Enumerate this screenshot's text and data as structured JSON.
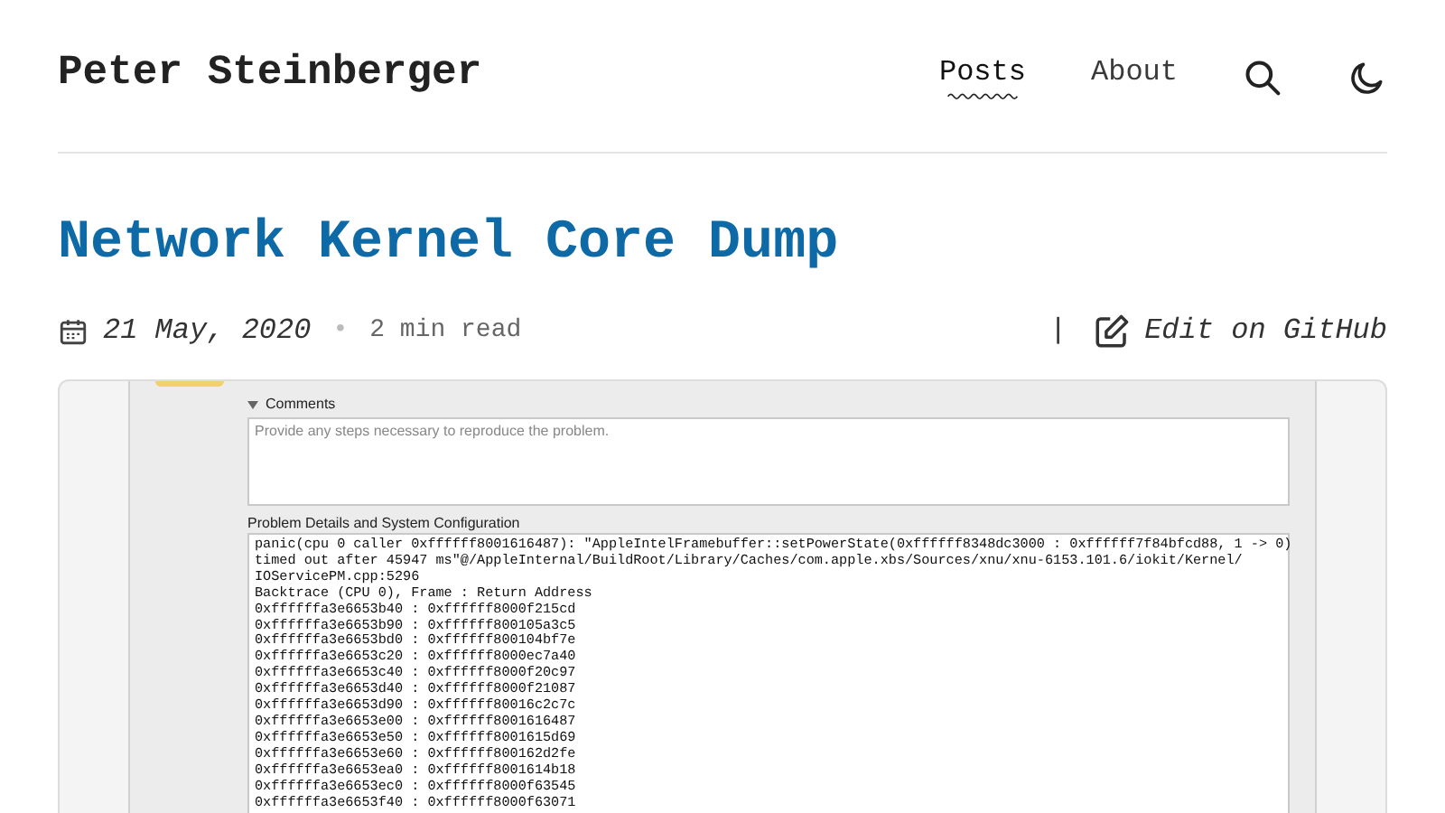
{
  "header": {
    "title": "Peter Steinberger",
    "nav": [
      {
        "label": "Posts",
        "selected": true
      },
      {
        "label": "About",
        "selected": false
      }
    ]
  },
  "post": {
    "title": "Network Kernel Core Dump",
    "date": "21 May, 2020",
    "separator": "•",
    "read_time": "2 min read",
    "divider": "|",
    "edit_label": "Edit on GitHub"
  },
  "screenshot": {
    "comments_label": "Comments",
    "comments_placeholder": "Provide any steps necessary to reproduce the problem.",
    "details_label": "Problem Details and System Configuration",
    "log_lines": [
      "panic(cpu 0 caller 0xffffff8001616487): \"AppleIntelFramebuffer::setPowerState(0xffffff8348dc3000 : 0xffffff7f84bfcd88, 1 -> 0)",
      "timed out after 45947 ms\"@/AppleInternal/BuildRoot/Library/Caches/com.apple.xbs/Sources/xnu/xnu-6153.101.6/iokit/Kernel/",
      "IOServicePM.cpp:5296",
      "Backtrace (CPU 0), Frame : Return Address",
      "0xffffffa3e6653b40 : 0xffffff8000f215cd",
      "0xffffffa3e6653b90 : 0xffffff800105a3c5",
      "0xffffffa3e6653bd0 : 0xffffff800104bf7e",
      "0xffffffa3e6653c20 : 0xffffff8000ec7a40",
      "0xffffffa3e6653c40 : 0xffffff8000f20c97",
      "0xffffffa3e6653d40 : 0xffffff8000f21087",
      "0xffffffa3e6653d90 : 0xffffff80016c2c7c",
      "0xffffffa3e6653e00 : 0xffffff8001616487",
      "0xffffffa3e6653e50 : 0xffffff8001615d69",
      "0xffffffa3e6653e60 : 0xffffff800162d2fe",
      "0xffffffa3e6653ea0 : 0xffffff8001614b18",
      "0xffffffa3e6653ec0 : 0xffffff8000f63545",
      "0xffffffa3e6653f40 : 0xffffff8000f63071"
    ]
  }
}
